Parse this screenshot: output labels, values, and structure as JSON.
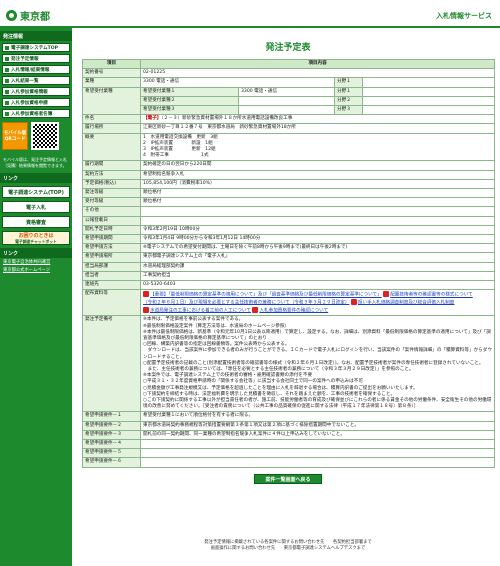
{
  "header": {
    "logo": "東京都",
    "site_title": "入札情報サービス"
  },
  "sidebar": {
    "heading": "発注情報",
    "items": [
      "電子調達システムTOP",
      "発注予定情報",
      "入札情報/結果情報",
      "入札結果一覧",
      "入札参加資格情報",
      "入札参加資格申請",
      "入札参加資格者名簿"
    ],
    "mobile_label": "モバイル版",
    "mobile_sub": "QRコード",
    "mobile_note": "モバイル版は、発注予定情報と入札（見積）結果情報を閲覧できます。",
    "links_heading": "リンク",
    "link_buttons": [
      "電子調達システム(TOP)",
      "電子入札",
      "資格審査"
    ],
    "orange_main": "お困りのときは",
    "orange_sub": "電子調達チャットボット",
    "bottom_heading": "リンク",
    "bottom_links": [
      "東京電子自治体共同運営",
      "東京都公式ホームページ"
    ]
  },
  "main": {
    "title": "発注予定表",
    "col_item": "項目",
    "col_content": "項目内容",
    "rows": {
      "contract_no_label": "契約番号",
      "contract_no": "02-01225",
      "category_label": "業種",
      "category": "3300 電話・通信",
      "bunya1": "分野１",
      "bunya2": "分野２",
      "bunya3": "分野３",
      "wish_label": "希望受付業種",
      "wish1_label": "希望受付業種１",
      "wish1": "3300 電話・通信",
      "wish2_label": "希望受付業種２",
      "wish3_label": "希望受付業種３",
      "name_label": "件名",
      "name_tag": "【電子】",
      "name_text": "（２－３）新砂緊急資材置場外１８か所水道用電話設備改良工事",
      "place_label": "履行場所",
      "place": "江東区新砂一丁目１２番７号　東京都水道局　新砂緊急資材置場外18か所",
      "summary_label": "概要",
      "summary": [
        "1　水道用電話交換設備　更新　3組",
        "2　IP拡声装置　　　　新設　1組",
        "3　IP拡声装置　　　　更新　12組",
        "4　附帯工事　　　　　　　1式"
      ],
      "period_label": "履行期間",
      "period": "契約確定の日の翌日から220日間",
      "method_label": "契約方法",
      "method": "希望制指名競争入札",
      "price_label": "予定価格(税込)",
      "price": "105,854,100円（消費税率10%）",
      "mode_label": "発注等級",
      "mode": "順位格付",
      "grade_label": "受付等級",
      "grade": "順位格付",
      "other_label": "その他",
      "pub_date_label": "公報登載日",
      "open_label": "開札予定日時",
      "open": "令和3年2月19日 10時00分",
      "apply_label": "希望申請期間",
      "apply": "令和3年1月4日 9時00分から令和3年1月12日 14時00分",
      "apply_method_label": "希望申請方法",
      "apply_method": "※電子システムでの希望受付期間は、土曜日を除く午前8時から午後9時まで(最終日は午後2時まで)",
      "accept_label": "希望申請場所",
      "accept": "東京都電子調達システム上の「電子入札」",
      "dept_label": "担当局部課",
      "dept": "水道局経理部契約課",
      "person_label": "担当者",
      "person": "工事契約担当",
      "tel_label": "連絡先",
      "tel": "03-5320-6403",
      "docs_label": "配布資料等",
      "doc1": "【重要】「最低制限価格の算定基準の適用について」及び「調査基準価格及び最低制限価格の算定基準について」",
      "doc1b": "配置技術者等の確認書等の様式について",
      "doc2": "（令和２年６月１日）及び現場を必要とする主任技術者の兼務について（令和３年３月２９日改定）",
      "doc2b": "担い手入札価格調査制度及び総合評価入札制度",
      "doc3": "水道局発注の工事における着工前の人工について",
      "doc3b": "入札参加資格要件の確認について",
      "notes_label": "発注予定備考",
      "notes": [
        "※本件は、予定価格を事前公表する案件である。",
        "※最低制限価格設定案件（算定方法等は、水道局のホームページ参照）",
        "※本件は最低制限価格は、新基準（令和元年10月1日公表以降適用）で算定し、設定する。なお、詳細は、別添資料「最低制限価格の算定基準の適用について」及び「調査基準価格及び最低制限価格の算定基準について」のとおり",
        "○回線、構築内訳書等の指定は回線書類等。案件公表時から公表する。",
        "　ダウンロードは、当該案件に参加できる者のみが行うことができる。ＩＣカードで電子入札にログインを行い、当該案件の「案件情報詳細」の「積算資料等」からダウンロードすること。",
        "○配置予定技術者の記載のこと(別添配置技術者等の確認書等の様式（令和２年６月１日改定）)。なお、配置予定技術者が案件の専任技術者に登録されていないこと。",
        "　また、主任技術者の兼務については、「専任を必要とする主任技術者の兼務について（令和３年３月２９日改定）」を参照のこと。",
        "※本案件では、電子調達システム上での技術者の審格・雇用確認書類の添付を不要",
        "○平成３１・３２年度資格申請時の「関係する会社等」に該当する会社同士で同一の案件への申込みは不可",
        "○見積金額が工事発注規模又は、予定価格を超過したことを理由に入札を辞退する場合は、積算内訳書のご提出をお願いいたします。",
        "○下請契約を締結する時は、法定福利費を明示した見積書を徴収し、それを踏まえた額を、工事の技術者を確保すること。",
        "○この下請契約に関係する工事以外が担当責任者の者が、施工前、技能労働者等の育成及び確保並びにこれらの者に係る賃金その他の労働条件、安全衛生その他の労働環境の改善に努めてください。［受注者の責務について（公共工事の品質確保の促進に関する法律（平成１７年法律第１８号）第８条）］"
      ],
      "wish_cond1_label": "希望申請要件－１",
      "wish_cond1": "希望受付業種１において順位格付を有する者に限る。",
      "wish_cond2_label": "希望申請要件－２",
      "wish_cond2": "東京都水道局契約事務規程等対策措置要綱第３条第１項又は第２項に基づく排除措置期間中でないこと。",
      "wish_cond3_label": "希望申請要件－３",
      "wish_cond3": "開札前の同一契約期間、同一業種の希望制指名競争入札案件に４件以上申込みをしていないこと。",
      "wish_cond4_label": "希望申請要件－４",
      "wish_cond5_label": "希望申請要件－５",
      "wish_cond6_label": "希望申請要件－６"
    },
    "back_button": "案件一覧画面へ戻る"
  },
  "footer": {
    "line1": "発注予定情報に掲載されている各案件に関するお問い合わせ先　　各契約担当部署まで",
    "line2": "画面操作に関するお問い合わせ先　　東京都電子調達システムヘルプデスクまで"
  }
}
